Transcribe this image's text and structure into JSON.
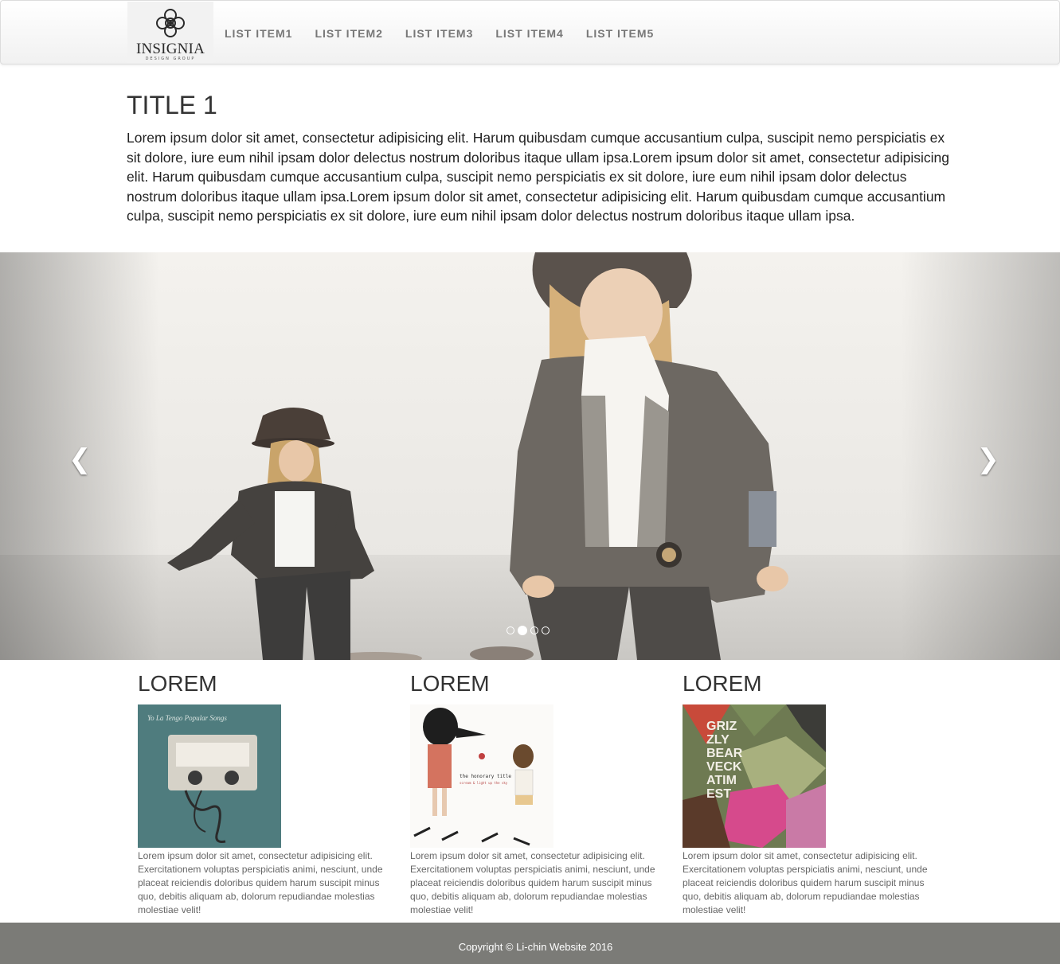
{
  "nav": {
    "logo": {
      "name": "INSIGNIA",
      "tagline": "DESIGN GROUP"
    },
    "items": [
      "LIST ITEM1",
      "LIST ITEM2",
      "LIST ITEM3",
      "LIST ITEM4",
      "LIST ITEM5"
    ]
  },
  "intro": {
    "title": "TITLE 1",
    "text": "Lorem ipsum dolor sit amet, consectetur adipisicing elit. Harum quibusdam cumque accusantium culpa, suscipit nemo perspiciatis ex sit dolore, iure eum nihil ipsam dolor delectus nostrum doloribus itaque ullam ipsa.Lorem ipsum dolor sit amet, consectetur adipisicing elit. Harum quibusdam cumque accusantium culpa, suscipit nemo perspiciatis ex sit dolore, iure eum nihil ipsam dolor delectus nostrum doloribus itaque ullam ipsa.Lorem ipsum dolor sit amet, consectetur adipisicing elit. Harum quibusdam cumque accusantium culpa, suscipit nemo perspiciatis ex sit dolore, iure eum nihil ipsam dolor delectus nostrum doloribus itaque ullam ipsa."
  },
  "carousel": {
    "prev_icon": "chevron-left-icon",
    "next_icon": "chevron-right-icon",
    "prev_glyph": "❮",
    "next_glyph": "❯",
    "slide_count": 4,
    "active_slide": 2
  },
  "columns": [
    {
      "title": "LOREM",
      "album_text": [
        "Yo La Tengo   Popular Songs"
      ],
      "text": "Lorem ipsum dolor sit amet, consectetur adipisicing elit. Exercitationem voluptas perspiciatis animi, nesciunt, unde placeat reiciendis doloribus quidem harum suscipit minus quo, debitis aliquam ab, dolorum repudiandae molestias molestiae velit!"
    },
    {
      "title": "LOREM",
      "album_text": [
        "the honorary title",
        "scream & light up the sky"
      ],
      "text": "Lorem ipsum dolor sit amet, consectetur adipisicing elit. Exercitationem voluptas perspiciatis animi, nesciunt, unde placeat reiciendis doloribus quidem harum suscipit minus quo, debitis aliquam ab, dolorum repudiandae molestias molestiae velit!"
    },
    {
      "title": "LOREM",
      "album_text": [
        "GRIZ",
        "ZLY",
        "BEAR",
        "VECK",
        "ATIM",
        "EST"
      ],
      "text": "Lorem ipsum dolor sit amet, consectetur adipisicing elit. Exercitationem voluptas perspiciatis animi, nesciunt, unde placeat reiciendis doloribus quidem harum suscipit minus quo, debitis aliquam ab, dolorum repudiandae molestias molestiae velit!"
    }
  ],
  "footer": {
    "copyright": "Copyright © Li-chin Website 2016"
  },
  "colors": {
    "footer_bg": "#7b7b77",
    "nav_text": "#777777",
    "body_text": "#333333"
  }
}
